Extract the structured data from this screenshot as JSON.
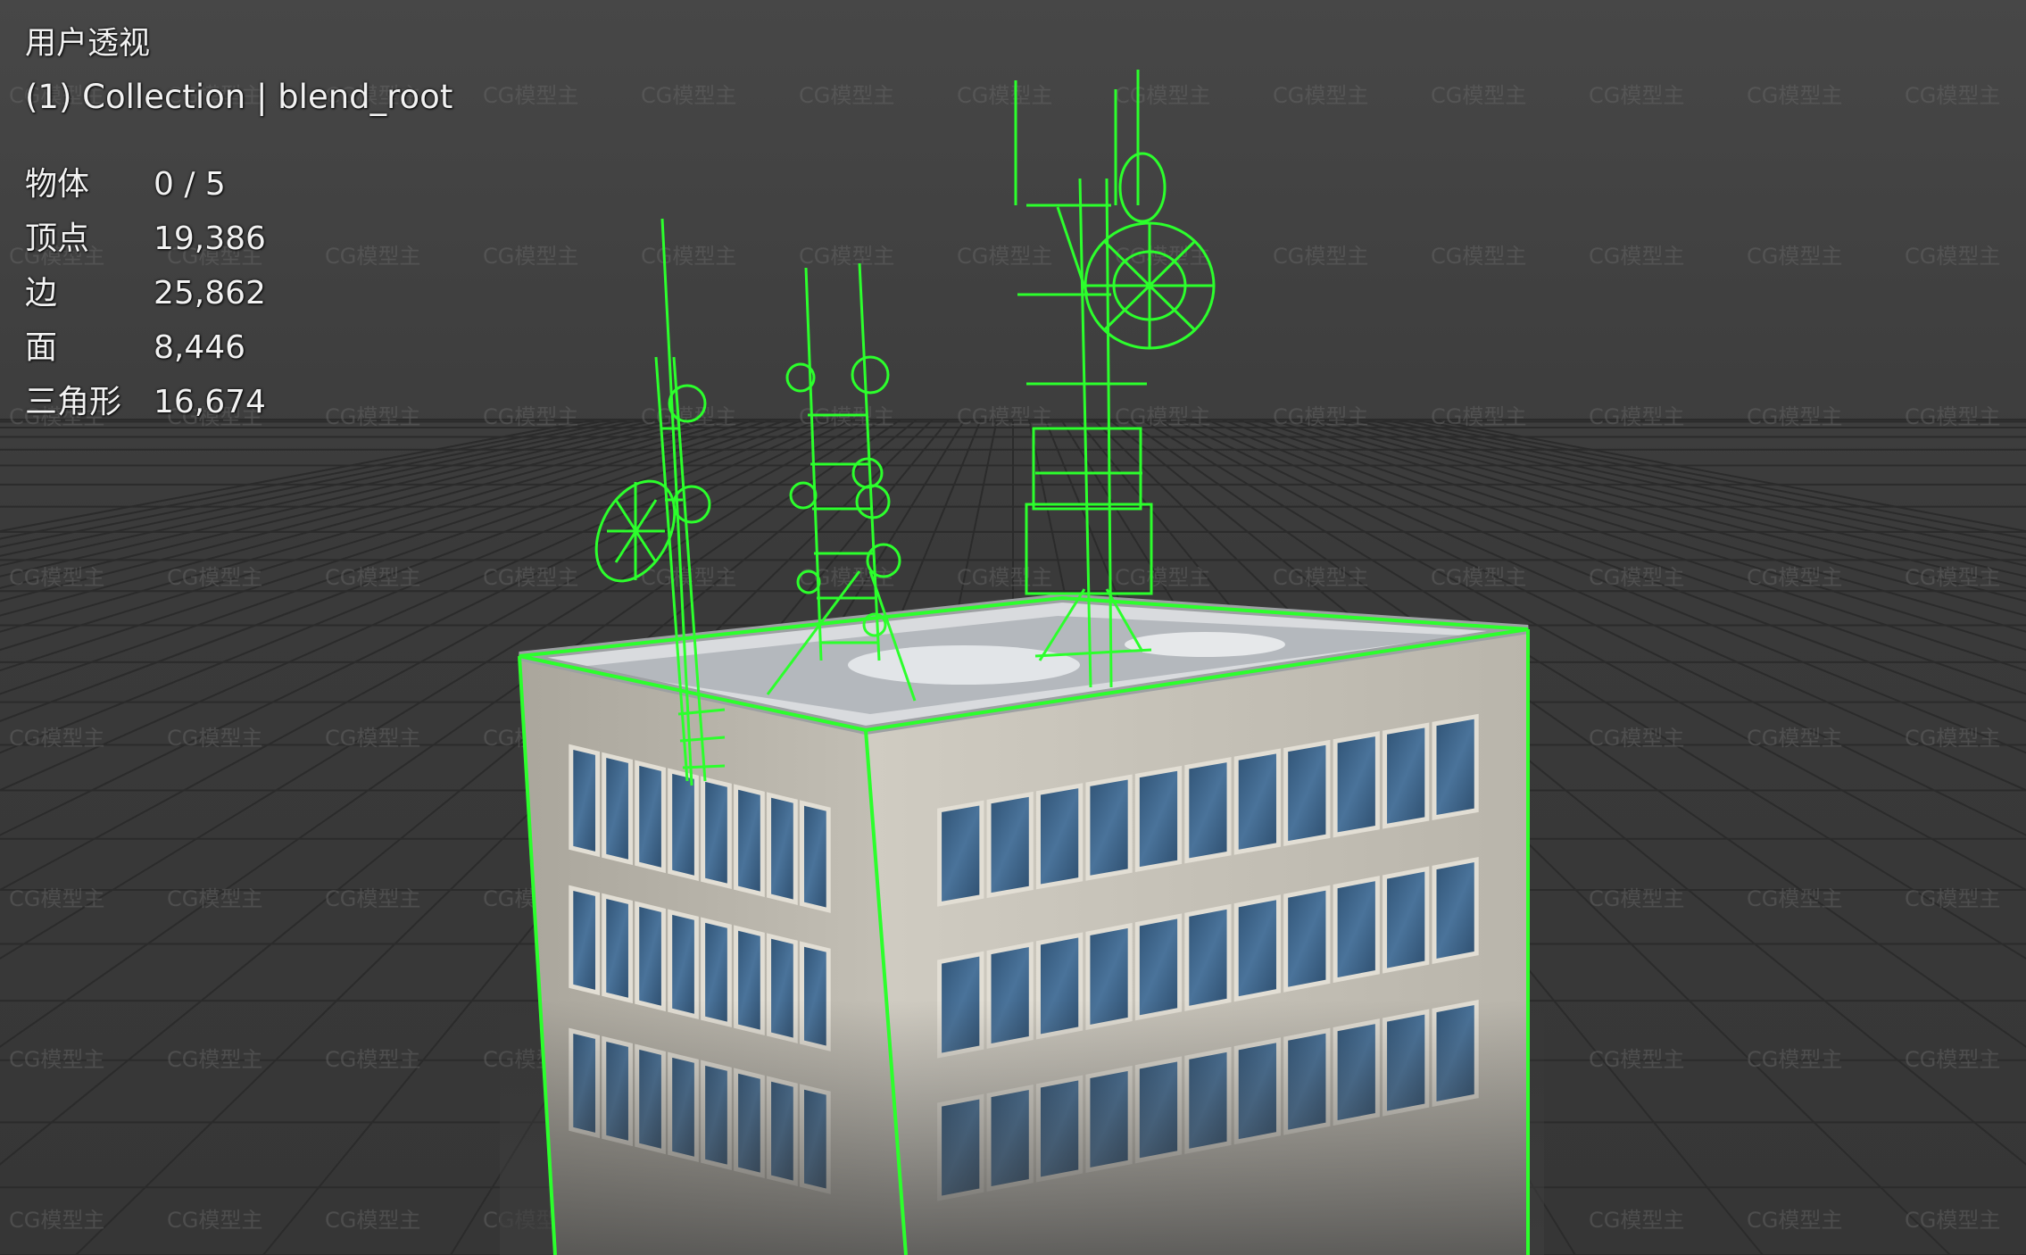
{
  "viewport": {
    "view_name": "用户透视",
    "collection_line": "(1) Collection | blend_root",
    "stats": [
      {
        "label": "物体",
        "value": "0 / 5"
      },
      {
        "label": "顶点",
        "value": "19,386"
      },
      {
        "label": "边",
        "value": "25,862"
      },
      {
        "label": "面",
        "value": "8,446"
      },
      {
        "label": "三角形",
        "value": "16,674"
      }
    ],
    "watermark": "CG模型主",
    "colors": {
      "background": "#3d3d3d",
      "grid": "#2a2a2a",
      "selection_outline": "#2cff2c",
      "wall": "#b9b5ab",
      "window_glass": "#3e6488"
    }
  }
}
